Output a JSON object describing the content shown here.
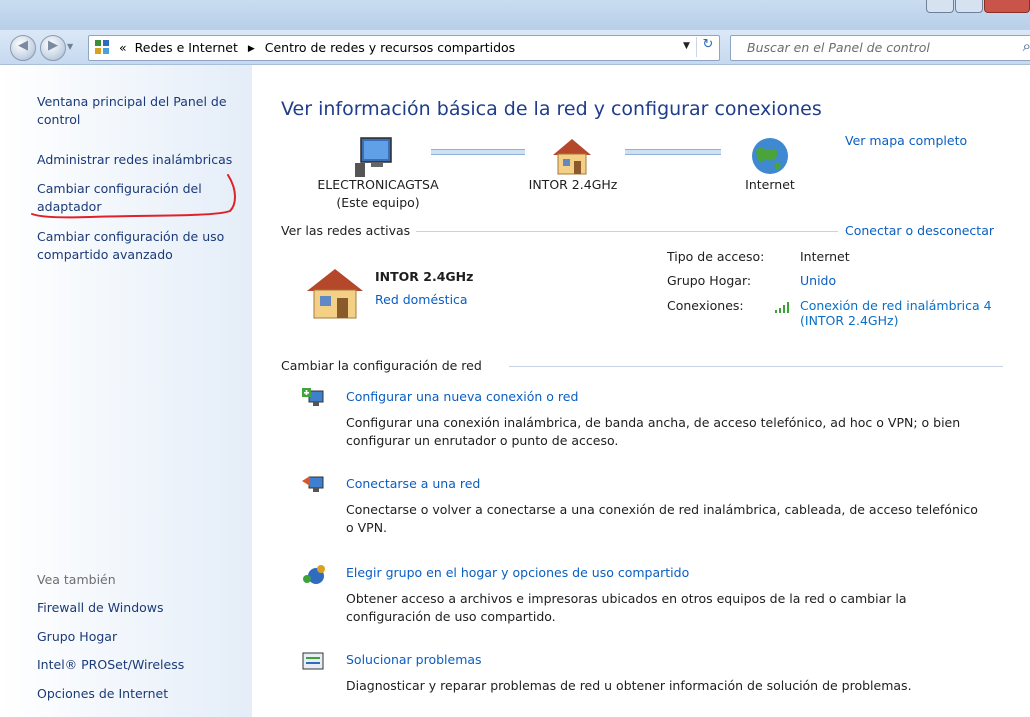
{
  "address_bar": {
    "history_glyph": "«",
    "crumbs": [
      "Redes e Internet",
      "Centro de redes y recursos compartidos"
    ],
    "crumb_separator": "▶",
    "dropdown_glyph": "▼",
    "refresh_glyph": "↻"
  },
  "search": {
    "placeholder": "Buscar en el Panel de control",
    "icon": "search-icon"
  },
  "left_pane": {
    "links": [
      "Ventana principal del Panel de control",
      "Administrar redes inalámbricas",
      "Cambiar configuración del adaptador",
      "Cambiar configuración de uso compartido avanzado"
    ],
    "see_also_label": "Vea también",
    "see_also": [
      "Firewall de Windows",
      "Grupo Hogar",
      "Intel® PROSet/Wireless",
      "Opciones de Internet"
    ],
    "annotation_color": "#e0212a"
  },
  "main": {
    "heading": "Ver información básica de la red y configurar conexiones",
    "full_map_link": "Ver mapa completo",
    "map": {
      "computer_name": "ELECTRONICAGTSA",
      "computer_sub": "(Este equipo)",
      "network_name": "INTOR 2.4GHz",
      "internet_label": "Internet"
    },
    "active_networks": {
      "label": "Ver las redes activas",
      "connect_link": "Conectar o desconectar",
      "network_name": "INTOR 2.4GHz",
      "network_type": "Red doméstica",
      "access_type_label": "Tipo de acceso:",
      "access_type_value": "Internet",
      "homegroup_label": "Grupo Hogar:",
      "homegroup_value": "Unido",
      "connections_label": "Conexiones:",
      "connection_value_line1": "Conexión de red inalámbrica 4",
      "connection_value_line2": "(INTOR 2.4GHz)"
    },
    "change_section": {
      "label": "Cambiar la configuración de red",
      "tasks": [
        {
          "title": "Configurar una nueva conexión o red",
          "desc_line1": "Configurar una conexión inalámbrica, de banda ancha, de acceso telefónico, ad hoc o VPN; o bien",
          "desc_line2": "configurar un enrutador o punto de acceso."
        },
        {
          "title": "Conectarse a una red",
          "desc_line1": "Conectarse o volver a conectarse a una conexión de red inalámbrica, cableada, de acceso telefónico",
          "desc_line2": "o VPN."
        },
        {
          "title": "Elegir grupo en el hogar y opciones de uso compartido",
          "desc_line1": "Obtener acceso a archivos e impresoras ubicados en otros equipos de la red o cambiar la",
          "desc_line2": "configuración de uso compartido."
        },
        {
          "title": "Solucionar problemas",
          "desc_line1": "Diagnosticar y reparar problemas de red u obtener información de solución de problemas."
        }
      ]
    }
  },
  "colors": {
    "link": "#0a5ec2",
    "heading": "#1f3d8a",
    "nav_gradient": "#c6d9ef",
    "left_pane_gradient": "#e4edf8"
  }
}
